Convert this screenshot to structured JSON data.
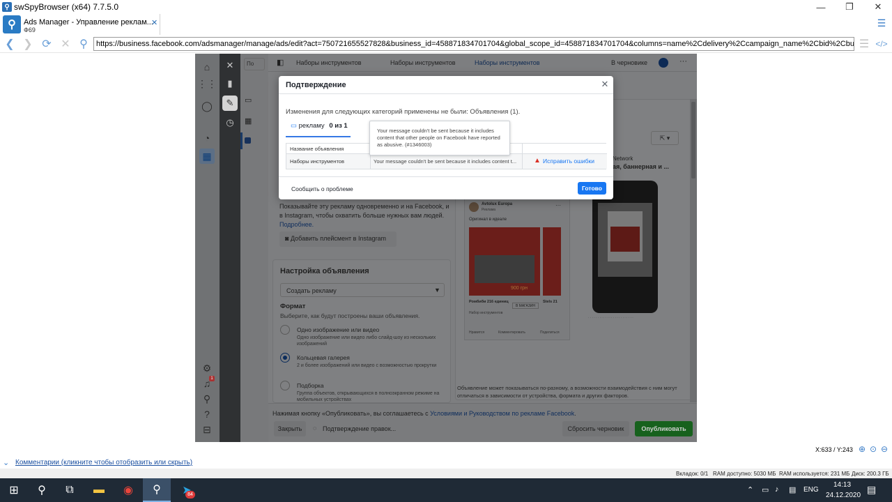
{
  "window": {
    "title": "swSpyBrowser (x64) 7.7.5.0",
    "minimize_icon": "minimize-icon",
    "maximize_icon": "maximize-icon",
    "close_icon": "close-icon"
  },
  "tab": {
    "title": "Ads Manager - Управление реклам...",
    "subtitle": "Ф69",
    "close": "✕"
  },
  "nav": {
    "url": "https://business.facebook.com/adsmanager/manage/ads/edit?act=750721655527828&business_id=458871834701704&global_scope_id=458871834701704&columns=name%2Cdelivery%2Ccampaign_name%2Cbid%2Cbudget%2Clast_significant_edit%2Cresults%2C"
  },
  "fb": {
    "search_placeholder": "По",
    "breadcrumb": [
      "Наборы инструментов",
      "Наборы инструментов",
      "Наборы инструментов"
    ],
    "draft_status": "В черновике",
    "network_title": "Network",
    "network_sub": "ая, баннерная и ...",
    "placement_text_1": "Показывайте эту рекламу одновременно и на Facebook, и",
    "placement_text_2": "в Instagram, чтобы охватить больше нужных вам людей.",
    "placement_link": "Подробнее.",
    "add_instagram": "Добавить плейсмент в Instagram",
    "ad_setup_title": "Настройка объявления",
    "create_ad_select": "Создать рекламу",
    "format_title": "Формат",
    "format_desc": "Выберите, как будут построены ваши объявления.",
    "formats": [
      {
        "label": "Одно изображение или видео",
        "desc": "Одно изображение или видео либо слайд-шоу из нескольких изображений",
        "selected": false
      },
      {
        "label": "Кольцевая галерея",
        "desc": "2 и более изображений или видео с возможностью прокрутки",
        "selected": true
      },
      {
        "label": "Подборка",
        "desc": "Группа объектов, открывающихся в полноэкранном режиме на мобильных устройствах",
        "selected": false
      }
    ],
    "preview_page": "Avtolux Europa",
    "preview_sponsored": "Реклама",
    "preview_caption": "Оригинал в идеале",
    "preview_price": "900 грн",
    "preview_card1_title": "Ромбиби 216 единиц",
    "preview_card1_sub": "Набор инструментов",
    "preview_card1_btn": "В МАГАЗИН",
    "preview_card2_title": "Stels 21",
    "preview_like": "Нравится",
    "preview_comment": "Комментировать",
    "preview_share": "Поделиться",
    "preview_note": "Объявление может показываться по-разному, а возможности взаимодействия с ним могут отличаться в зависимости от устройства, формата и других факторов.",
    "footer_text_pre": "Нажимая кнопку «Опубликовать», вы соглашаетесь с ",
    "footer_link": "Условиями и Руководством по рекламе Facebook",
    "footer_text_post": ".",
    "close_btn": "Закрыть",
    "confirm_status": "Подтверждение правок...",
    "reset_draft": "Сбросить черновик",
    "publish": "Опубликовать"
  },
  "modal": {
    "title": "Подтверждение",
    "message": "Изменения для следующих категорий применены не были: Объявления (1).",
    "tab_label": "рекламу",
    "tab_count": "0 из 1",
    "col_name": "Название объявления",
    "row_name": "Наборы инструментов",
    "row_error": "Your message couldn't be sent because it includes content t...",
    "fix_link": "Исправить ошибки",
    "report": "Сообщить о проблеме",
    "done": "Готово",
    "tooltip": "Your message couldn't be sent because it includes content that other people on Facebook have reported as abusive. (#1346003)"
  },
  "status": {
    "coords": "X:633 / Y:243",
    "comments": "Комментарии (кликните чтобы отобразить или скрыть)",
    "tabs": "Вкладок: 0/1",
    "ram_avail": "RAM доступно: 5030 МБ",
    "ram_used": "RAM используется: 231 МБ",
    "disk": "Диск: 200.3 ГБ"
  },
  "taskbar": {
    "lang": "ENG",
    "time": "14:13",
    "date": "24.12.2020",
    "telegram_badge": "84",
    "notif_badge": "1"
  }
}
